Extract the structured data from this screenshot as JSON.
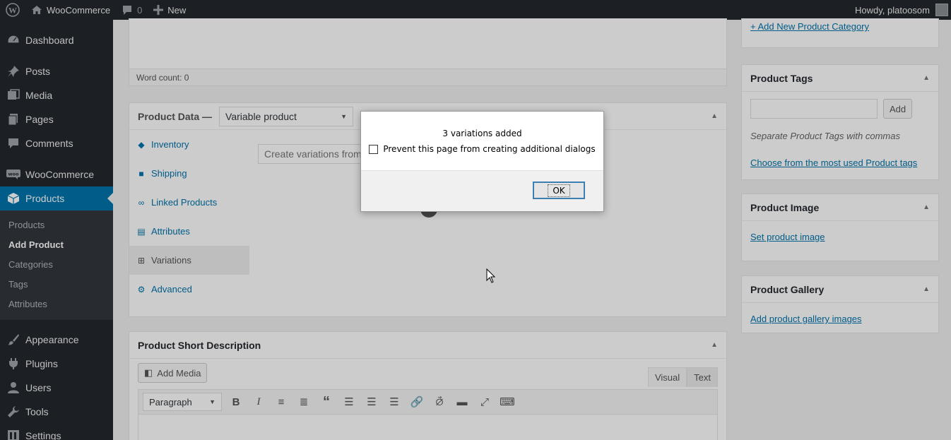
{
  "adminbar": {
    "site_name": "WooCommerce",
    "comments_count": "0",
    "new_label": "New",
    "howdy": "Howdy, platoosom"
  },
  "sidebar": {
    "items": [
      {
        "label": "Dashboard",
        "icon": "dashboard-icon"
      },
      {
        "label": "Posts",
        "icon": "pin-icon"
      },
      {
        "label": "Media",
        "icon": "media-icon"
      },
      {
        "label": "Pages",
        "icon": "pages-icon"
      },
      {
        "label": "Comments",
        "icon": "comment-icon"
      },
      {
        "label": "WooCommerce",
        "icon": "woo-icon"
      },
      {
        "label": "Products",
        "icon": "products-icon"
      },
      {
        "label": "Appearance",
        "icon": "brush-icon"
      },
      {
        "label": "Plugins",
        "icon": "plugin-icon"
      },
      {
        "label": "Users",
        "icon": "user-icon"
      },
      {
        "label": "Tools",
        "icon": "wrench-icon"
      },
      {
        "label": "Settings",
        "icon": "settings-icon"
      }
    ],
    "submenu": [
      "Products",
      "Add Product",
      "Categories",
      "Tags",
      "Attributes"
    ]
  },
  "editor": {
    "word_count": "Word count: 0"
  },
  "product_data": {
    "title": "Product Data —",
    "type_select": "Variable product",
    "variations_select": "Create variations from",
    "tabs": [
      "Inventory",
      "Shipping",
      "Linked Products",
      "Attributes",
      "Variations",
      "Advanced"
    ]
  },
  "short_description": {
    "title": "Product Short Description",
    "add_media": "Add Media",
    "tab_visual": "Visual",
    "tab_text": "Text",
    "format_select": "Paragraph"
  },
  "right_column": {
    "add_category_link": "+ Add New Product Category",
    "tags": {
      "title": "Product Tags",
      "add_button": "Add",
      "hint": "Separate Product Tags with commas",
      "choose_link": "Choose from the most used Product tags"
    },
    "image": {
      "title": "Product Image",
      "link": "Set product image"
    },
    "gallery": {
      "title": "Product Gallery",
      "link": "Add product gallery images"
    }
  },
  "dialog": {
    "message": "3 variations added",
    "checkbox_label": "Prevent this page from creating additional dialogs",
    "ok_label": "OK"
  },
  "colors": {
    "admin_dark": "#23282d",
    "accent": "#0073aa",
    "background": "#f1f1f1"
  }
}
